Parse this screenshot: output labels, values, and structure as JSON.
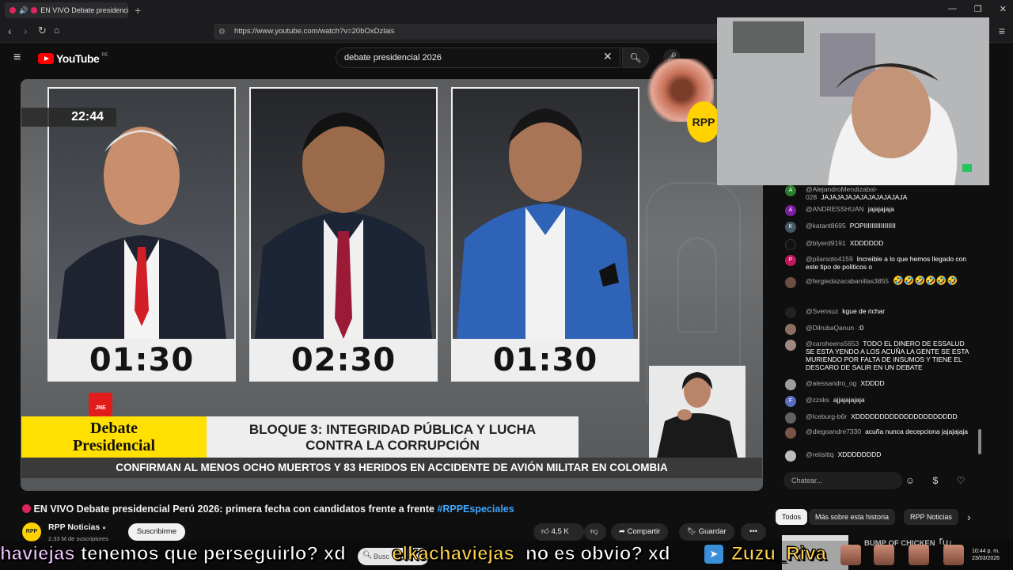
{
  "browser": {
    "tab_title": "EN VIVO Debate presidenci",
    "url": "https://www.youtube.com/watch?v=20bOxDzlais",
    "new_tab": "+"
  },
  "youtube": {
    "logo_text": "YouTube",
    "region": "PE",
    "search_value": "debate presidencial 2026"
  },
  "video": {
    "clock": "22:44",
    "timers": [
      "01:30",
      "02:30",
      "01:30"
    ],
    "jne_logo": "JNE",
    "program_title_1": "Debate",
    "program_title_2": "Presidencial",
    "block_title_1": "BLOQUE 3: INTEGRIDAD PÚBLICA Y LUCHA",
    "block_title_2": "CONTRA LA CORRUPCIÓN",
    "ticker": "CONFIRMAN AL MENOS OCHO MUERTOS Y 83 HERIDOS EN ACCIDENTE DE AVIÓN MILITAR EN COLOMBIA",
    "rpp_logo": "RPP"
  },
  "chat": {
    "messages": [
      {
        "author": "@AlejandroMendizabal-028",
        "text": "JAJAJAJAJAJAJAJAJAJAJA",
        "avatar": "A",
        "avatar_color": "#2e7d32"
      },
      {
        "author": "@ANDRESSHUAN",
        "text": "jajajajaja",
        "avatar": "A",
        "avatar_color": "#7b1fa2"
      },
      {
        "author": "@katant8695",
        "text": "POPIIIIIIIIIIIIIIIII",
        "avatar": "K",
        "avatar_color": "#455a64"
      },
      {
        "author": "@blyerd9191",
        "text": "XDDDDDD",
        "avatar": "",
        "avatar_color": "#111111"
      },
      {
        "author": "@pilarsoto4159",
        "text": "Increible a lo que hemos llegado con este tipo de politicos o",
        "avatar": "P",
        "avatar_color": "#c2185b"
      },
      {
        "author": "@fergiedazacabanillas3855",
        "text": "🤣🤣🤣🤣🤣🤣",
        "avatar": "",
        "avatar_color": "#6d4c41"
      },
      {
        "author": "@Svensuz",
        "text": "kgue de richar",
        "avatar": "",
        "avatar_color": "#222222"
      },
      {
        "author": "@DilrubaQanun",
        "text": ":0",
        "avatar": "",
        "avatar_color": "#8d6e63"
      },
      {
        "author": "@caroheens5653",
        "text": "TODO EL DINERO DE ESSALUD SE ESTA YENDO A LOS ACUÑA LA GENTE SE ESTA MURIENDO POR FALTA DE INSUMOS Y TIENE EL DESCARO DE SALIR EN UN DEBATE",
        "avatar": "",
        "avatar_color": "#a1887f"
      },
      {
        "author": "@alessandro_og",
        "text": "XDDDD",
        "avatar": "",
        "avatar_color": "#9e9e9e"
      },
      {
        "author": "@zzsks",
        "text": "ajjajajajaja",
        "avatar": "F",
        "avatar_color": "#5c6bc0"
      },
      {
        "author": "@Iceburg-b6r",
        "text": "XDDDDDDDDDDDDDDDDDDDDD",
        "avatar": "",
        "avatar_color": "#616161"
      },
      {
        "author": "@diegoandre7330",
        "text": "acuña nunca decepciona jajajajaja",
        "avatar": "",
        "avatar_color": "#795548"
      },
      {
        "author": "@reiisittq",
        "text": "XDDDDDDDD",
        "avatar": "",
        "avatar_color": "#bdbdbd"
      }
    ],
    "input_placeholder": "Chatear..."
  },
  "watch": {
    "title_main": "EN VIVO Debate presidencial Perú 2026: primera fecha con candidatos frente a frente",
    "title_tag": "#RPPEspeciales",
    "channel_name": "RPP Noticias",
    "channel_logo": "RPP",
    "subscribers": "2,33 M de suscriptores",
    "subscribe_label": "Suscribirme",
    "likes": "4,5 K",
    "share_label": "Compartir",
    "save_label": "Guardar",
    "more": "•••"
  },
  "related": {
    "chips": [
      "Todos",
      "Más sobre esta historia",
      "RPP Noticias"
    ],
    "first_title": "BUMP OF CHICKEN「U」"
  },
  "overlay": {
    "ticker_parts": [
      "haviejas",
      "tenemos que perseguirlo? xd",
      "elkachaviejas",
      "no es obvio? xd",
      "Zuzu_Riva"
    ],
    "taskbar_search": "Busc",
    "time": "10:44 p. m.",
    "date": "23/03/2026"
  },
  "colors": {
    "accent_blue": "#3ea6ff",
    "youtube_red": "#ff0000",
    "banner_yellow": "#ffe000"
  }
}
